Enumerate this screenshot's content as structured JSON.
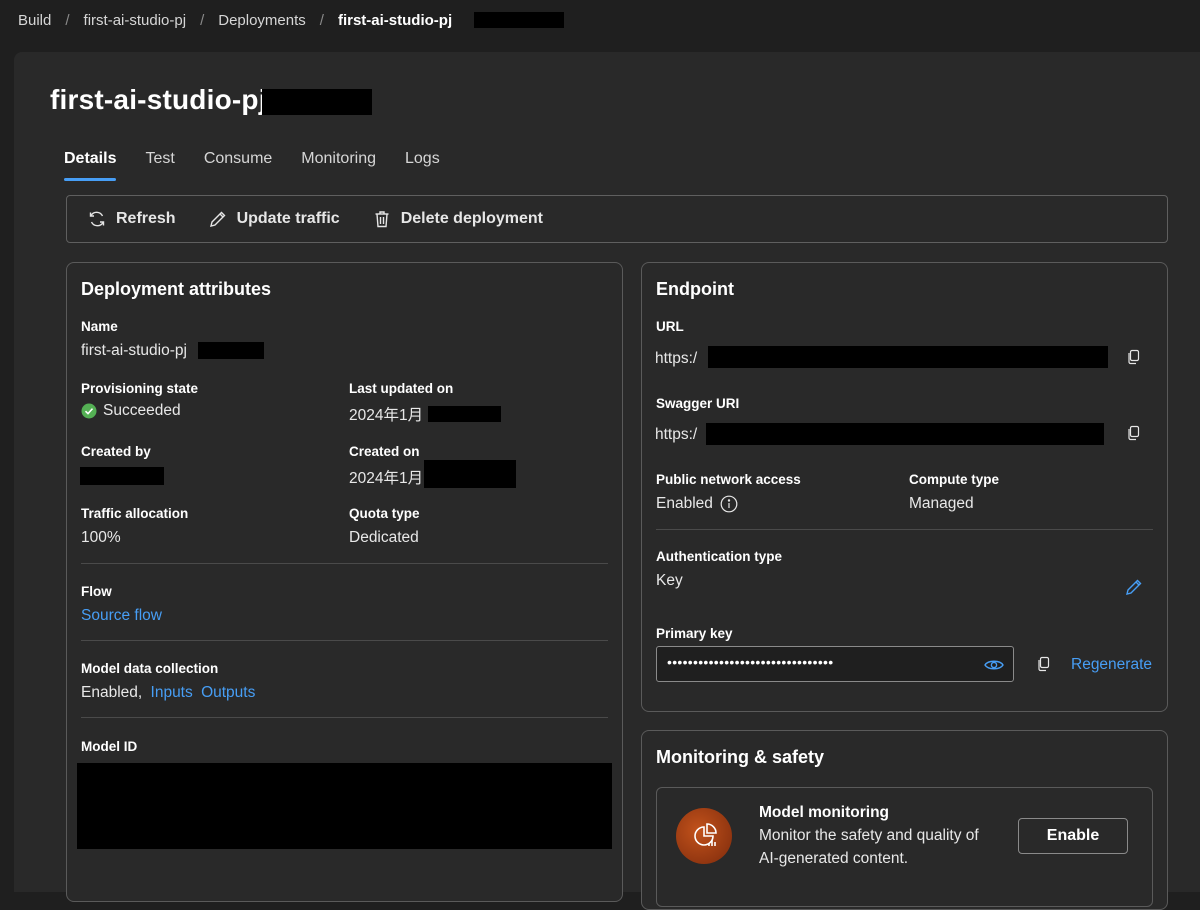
{
  "breadcrumb": {
    "items": [
      "Build",
      "first-ai-studio-pj",
      "Deployments"
    ],
    "current": "first-ai-studio-pj"
  },
  "page": {
    "title": "first-ai-studio-pj-"
  },
  "tabs": [
    {
      "label": "Details",
      "active": true
    },
    {
      "label": "Test",
      "active": false
    },
    {
      "label": "Consume",
      "active": false
    },
    {
      "label": "Monitoring",
      "active": false
    },
    {
      "label": "Logs",
      "active": false
    }
  ],
  "toolbar": {
    "refresh": "Refresh",
    "update_traffic": "Update traffic",
    "delete_deployment": "Delete deployment"
  },
  "attributes": {
    "title": "Deployment attributes",
    "name_label": "Name",
    "name_value": "first-ai-studio-pj",
    "provisioning_label": "Provisioning state",
    "provisioning_value": "Succeeded",
    "last_updated_label": "Last updated on",
    "last_updated_value": "2024年1月",
    "created_by_label": "Created by",
    "created_on_label": "Created on",
    "created_on_value": "2024年1月",
    "traffic_label": "Traffic allocation",
    "traffic_value": "100%",
    "quota_label": "Quota type",
    "quota_value": "Dedicated",
    "flow_label": "Flow",
    "flow_link": "Source flow",
    "mdc_label": "Model data collection",
    "mdc_value": "Enabled,",
    "mdc_inputs": "Inputs",
    "mdc_outputs": "Outputs",
    "model_id_label": "Model ID"
  },
  "endpoint": {
    "title": "Endpoint",
    "url_label": "URL",
    "url_value": "https:/",
    "swagger_label": "Swagger URI",
    "swagger_value": "https:/",
    "public_access_label": "Public network access",
    "public_access_value": "Enabled",
    "compute_label": "Compute type",
    "compute_value": "Managed",
    "auth_label": "Authentication type",
    "auth_value": "Key",
    "primary_key_label": "Primary key",
    "primary_key_value": "••••••••••••••••••••••••••••••••",
    "regenerate": "Regenerate"
  },
  "monitoring": {
    "title": "Monitoring & safety",
    "model_monitoring_title": "Model monitoring",
    "model_monitoring_desc_1": "Monitor the safety and quality of",
    "model_monitoring_desc_2": "AI-generated content.",
    "enable": "Enable"
  },
  "colors": {
    "accent": "#479ef5",
    "success": "#54b054",
    "panel": "#292929",
    "background": "#1f1f1f"
  }
}
